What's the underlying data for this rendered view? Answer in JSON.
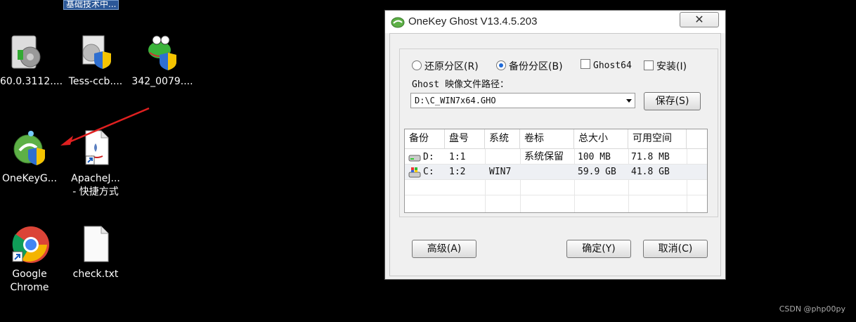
{
  "desktop": {
    "top_label": "基础技术中...",
    "icons": [
      {
        "label": "60.0.3112....",
        "icon": "chrome-installer-icon"
      },
      {
        "label": "Tess-ccb....",
        "icon": "installer-shield-icon"
      },
      {
        "label": "342_0079....",
        "icon": "chameleon-shield-icon"
      },
      {
        "label": "OneKeyG...",
        "icon": "onekey-ghost-icon"
      },
      {
        "label": "ApacheJ...",
        "label2": "- 快捷方式",
        "icon": "java-shortcut-icon"
      },
      {
        "label": "Google",
        "label2": "Chrome",
        "icon": "chrome-icon"
      },
      {
        "label": "check.txt",
        "icon": "text-file-icon"
      }
    ],
    "watermark": "CSDN @php00py"
  },
  "window": {
    "title": "OneKey Ghost V13.4.5.203",
    "close": "✕",
    "options": [
      {
        "label": "还原分区(R)",
        "type": "radio",
        "checked": false
      },
      {
        "label": "备份分区(B)",
        "type": "radio",
        "checked": true
      },
      {
        "label": "Ghost64",
        "type": "checkbox",
        "checked": false
      },
      {
        "label": "安装(I)",
        "type": "checkbox",
        "checked": false
      }
    ],
    "path_label": "Ghost 映像文件路径：",
    "path_value": "D:\\C_WIN7x64.GHO",
    "save_button": "保存(S)",
    "table": {
      "headers": [
        "备份",
        "盘号",
        "系统",
        "卷标",
        "总大小",
        "可用空间"
      ],
      "rows": [
        {
          "drive": "D:",
          "disk": "1:1",
          "system": "",
          "label": "系统保留",
          "total": "100 MB",
          "free": "71.8 MB"
        },
        {
          "drive": "C:",
          "disk": "1:2",
          "system": "WIN7",
          "label": "",
          "total": "59.9 GB",
          "free": "41.8 GB"
        }
      ]
    },
    "advanced_button": "高级(A)",
    "ok_button": "确定(Y)",
    "cancel_button": "取消(C)"
  }
}
